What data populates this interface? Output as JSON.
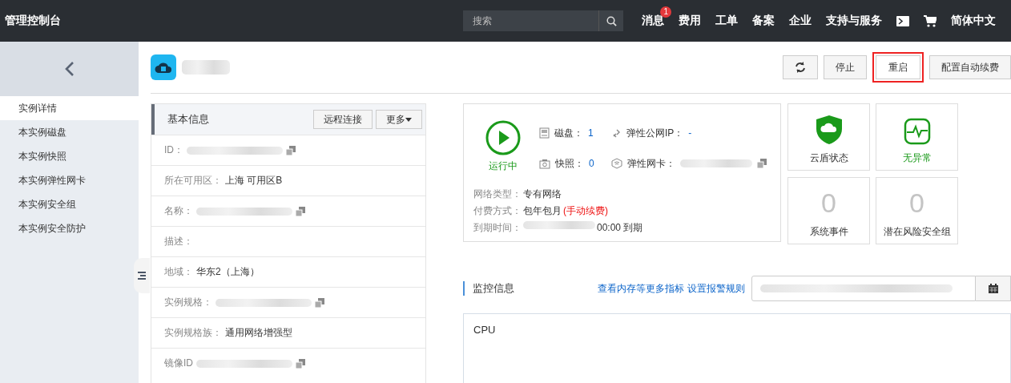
{
  "topbar": {
    "title": "管理控制台",
    "search": {
      "placeholder": "搜索"
    },
    "nav": [
      {
        "kind": "text",
        "label": "消息",
        "badge": "1"
      },
      {
        "kind": "text",
        "label": "费用"
      },
      {
        "kind": "text",
        "label": "工单"
      },
      {
        "kind": "text",
        "label": "备案"
      },
      {
        "kind": "text",
        "label": "企业"
      },
      {
        "kind": "text",
        "label": "支持与服务"
      },
      {
        "kind": "terminal"
      },
      {
        "kind": "cart"
      },
      {
        "kind": "text",
        "label": "简体中文"
      }
    ]
  },
  "sidebar": {
    "items": [
      {
        "label": "实例详情",
        "selected": true
      },
      {
        "label": "本实例磁盘",
        "selected": false
      },
      {
        "label": "本实例快照",
        "selected": false
      },
      {
        "label": "本实例弹性网卡",
        "selected": false
      },
      {
        "label": "本实例安全组",
        "selected": false
      },
      {
        "label": "本实例安全防护",
        "selected": false
      }
    ]
  },
  "header": {
    "title_redacted": true,
    "buttons": [
      {
        "kind": "refresh",
        "highlighted": false
      },
      {
        "kind": "text",
        "label": "停止",
        "highlighted": false
      },
      {
        "kind": "text",
        "label": "重启",
        "highlighted": true
      },
      {
        "kind": "text",
        "label": "配置自动续费",
        "highlighted": false
      }
    ]
  },
  "basic_info": {
    "title": "基本信息",
    "actions": [
      {
        "label": "远程连接",
        "caret": false
      },
      {
        "label": "更多",
        "caret": true
      }
    ],
    "rows": [
      {
        "label": "ID：",
        "redacted": true,
        "copy": true
      },
      {
        "label": "所在可用区：",
        "value": "上海 可用区B"
      },
      {
        "label": "名称：",
        "redacted": true,
        "copy": true
      },
      {
        "label": "描述："
      },
      {
        "label": "地域：",
        "value": "华东2（上海）"
      },
      {
        "label": "实例规格：",
        "redacted": true,
        "copy": true
      },
      {
        "label": "实例规格族：",
        "value": "通用网络增强型"
      },
      {
        "label": "镜像ID",
        "redacted": true,
        "copy": true
      }
    ]
  },
  "status": {
    "state": "运行中",
    "stats": [
      {
        "kind": "disk",
        "label": "磁盘：",
        "value": "1"
      },
      {
        "kind": "eip",
        "label": "弹性公网IP：",
        "value": "-"
      },
      {
        "kind": "snapshot",
        "label": "快照：",
        "value": "0"
      },
      {
        "kind": "eni",
        "label": "弹性网卡：",
        "redacted": true,
        "copy": true
      }
    ],
    "details": [
      {
        "label": "网络类型：",
        "value": "专有网络"
      },
      {
        "label": "付费方式：",
        "value": "包年包月",
        "note": "(手动续费)"
      },
      {
        "label": "到期时间：",
        "redacted": true,
        "value": "00:00 到期"
      }
    ]
  },
  "tiles": [
    {
      "kind": "shield",
      "label": "云盾状态",
      "ok": false
    },
    {
      "kind": "pulse",
      "label": "无异常",
      "ok": true
    },
    {
      "kind": "count",
      "value": "0",
      "label": "系统事件",
      "ok": false
    },
    {
      "kind": "count",
      "value": "0",
      "label": "潜在风险安全组",
      "ok": false
    }
  ],
  "monitor": {
    "title": "监控信息",
    "links": [
      "查看内存等更多指标",
      "设置报警规则"
    ],
    "range_redacted": true,
    "chart_title": "CPU"
  }
}
